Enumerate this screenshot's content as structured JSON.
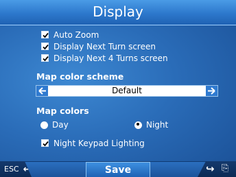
{
  "header": {
    "title": "Display"
  },
  "options": [
    {
      "label": "Auto Zoom",
      "checked": true
    },
    {
      "label": "Display Next Turn screen",
      "checked": true
    },
    {
      "label": "Display Next 4 Turns screen",
      "checked": true
    }
  ],
  "map_color_scheme": {
    "label": "Map color scheme",
    "value": "Default",
    "left_arrow": "left-arrow-icon",
    "right_arrow": "right-arrow-icon"
  },
  "map_colors": {
    "label": "Map colors",
    "day_label": "Day",
    "night_label": "Night",
    "selected": "Night"
  },
  "night_keypad": {
    "label": "Night Keypad Lighting",
    "checked": true
  },
  "footer": {
    "esc_label": "ESC",
    "save_label": "Save",
    "icons": [
      "back-arrow-icon",
      "next-arrow-icon",
      "keyboard-icon"
    ]
  },
  "colors": {
    "background": "#2a6cb8",
    "title_bar": "#2d78cc",
    "select_arrow": "#2f7ad0"
  }
}
